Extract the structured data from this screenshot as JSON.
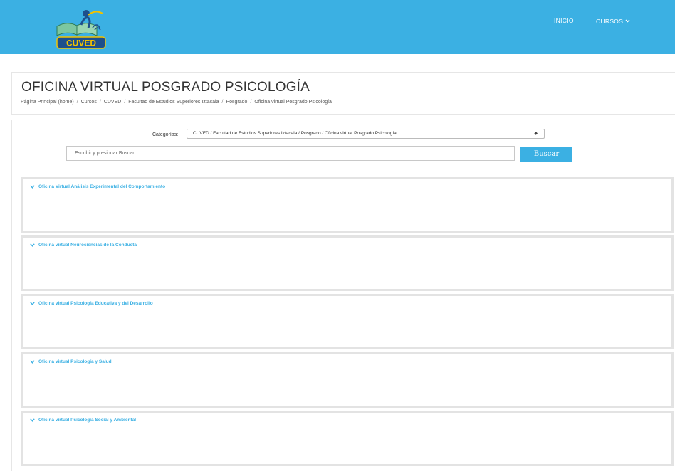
{
  "header": {
    "logo_text": "CUVED",
    "nav": {
      "inicio": "INICIO",
      "cursos": "CURSOS"
    }
  },
  "page": {
    "title": "OFICINA VIRTUAL POSGRADO PSICOLOGÍA",
    "breadcrumb": [
      "Página Principal (home)",
      "Cursos",
      "CUVED",
      "Facultad de Estudios Superiores Iztacala",
      "Posgrado",
      "Oficina virtual Posgrado Psicología"
    ]
  },
  "filters": {
    "category_label": "Categorías:",
    "category_value": "CUVED / Facultad de Estudios Superiores Iztacala / Posgrado / Oficina virtual Posgrado Psicología",
    "search_placeholder": "Escribir y presionar Buscar",
    "search_button": "Buscar"
  },
  "categories": [
    "Oficina Virtual Análisis Experimental del Comportamiento",
    "Oficina virtual Neurociencias de la Conducta",
    "Oficina virtual Psicología Educativa y del Desarrollo",
    "Oficina virtual Psicología y Salud",
    "Oficina virtual Psicología Social y Ambiental"
  ],
  "colors": {
    "brand": "#3bb0e3",
    "border": "#e3e3e3"
  }
}
